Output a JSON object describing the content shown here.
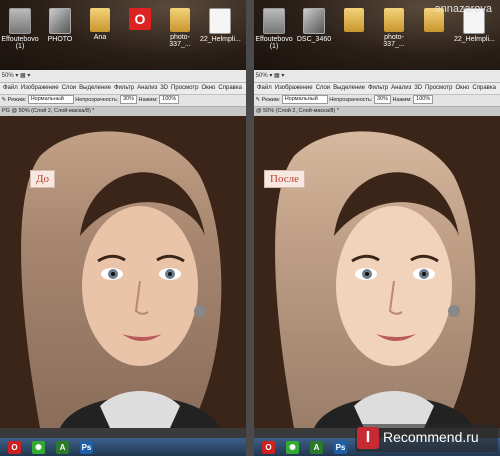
{
  "watermark": "annazarova",
  "brand": {
    "icon": "I",
    "text": "Recommend.ru"
  },
  "left": {
    "desktop": [
      {
        "label": "Effoutebovo (1)",
        "icon": "gray"
      },
      {
        "label": "PHOTO",
        "icon": "photo"
      },
      {
        "label": "Ana",
        "icon": "folder"
      },
      {
        "label": "",
        "icon": "opera"
      },
      {
        "label": "photo-337_...",
        "icon": "folder"
      },
      {
        "label": "22_Helmpli...",
        "icon": "doc"
      }
    ],
    "zoom": "50%",
    "menu": [
      "Файл",
      "Изображение",
      "Слои",
      "Выделение",
      "Фильтр",
      "Анализ",
      "3D",
      "Просмотр",
      "Окно",
      "Справка"
    ],
    "mode_label": "Режим:",
    "mode_value": "Нормальный",
    "opacity_label": "Непрозрачность:",
    "opacity_value": "30%",
    "flow_label": "Нажим:",
    "flow_value": "100%",
    "tab": "PG @ 50% (Слой 2, Слой-маска/8) *",
    "badge": "До"
  },
  "right": {
    "desktop": [
      {
        "label": "Effoutebovo (1)",
        "icon": "gray"
      },
      {
        "label": "DSC_3460",
        "icon": "photo"
      },
      {
        "label": "",
        "icon": "folder"
      },
      {
        "label": "photo-337_...",
        "icon": "folder"
      },
      {
        "label": "",
        "icon": "folder"
      },
      {
        "label": "22_Helmpli...",
        "icon": "doc"
      }
    ],
    "zoom": "50%",
    "menu": [
      "Файл",
      "Изображение",
      "Слои",
      "Выделение",
      "Фильтр",
      "Анализ",
      "3D",
      "Просмотр",
      "Окно",
      "Справка"
    ],
    "mode_label": "Режим:",
    "mode_value": "Нормальный",
    "opacity_label": "Непрозрачность:",
    "opacity_value": "30%",
    "flow_label": "Нажим:",
    "flow_value": "100%",
    "tab": "@ 50% (Слой 2, Слой-маска/8) *",
    "badge": "После"
  },
  "taskbar": [
    {
      "icon": "opera",
      "char": "O",
      "color": "#c22"
    },
    {
      "icon": "star",
      "char": "✺",
      "color": "#3a3"
    },
    {
      "icon": "acrobat",
      "char": "A",
      "color": "#2b7a2b"
    },
    {
      "icon": "photoshop",
      "char": "Ps",
      "color": "#1f5fa8"
    }
  ]
}
